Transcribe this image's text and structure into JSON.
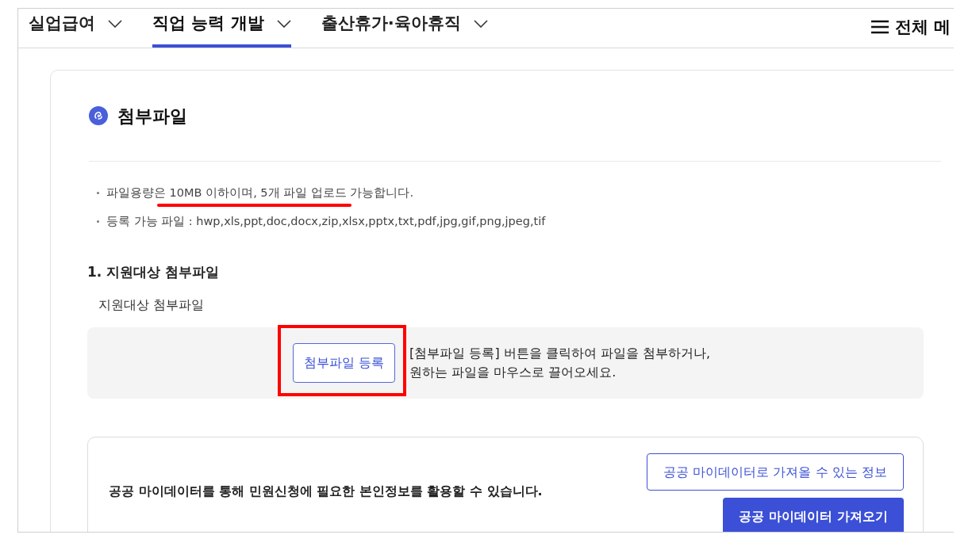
{
  "nav": {
    "tabs": [
      {
        "label": "실업급여",
        "selected": false
      },
      {
        "label": "직업 능력 개발",
        "selected": true
      },
      {
        "label": "출산휴가·육아휴직",
        "selected": false
      }
    ],
    "all_menu": "전체 메"
  },
  "section": {
    "title": "첨부파일",
    "notes": [
      {
        "text": "파일용량은 10MB 이하이며, 5개 파일 업로드 가능합니다.",
        "underlined": true
      },
      {
        "text": "등록 가능 파일 : hwp,xls,ppt,doc,docx,zip,xlsx,pptx,txt,pdf,jpg,gif,png,jpeg,tif",
        "underlined": false
      }
    ],
    "subheading": "1. 지원대상 첨부파일",
    "field_label": "지원대상 첨부파일",
    "upload": {
      "button": "첨부파일 등록",
      "highlighted": true,
      "hint_lines": [
        "[첨부파일 등록] 버튼을 클릭하여 파일을 첨부하거나,",
        "원하는 파일을 마우스로 끌어오세요."
      ]
    }
  },
  "mydata": {
    "text": "공공 마이데이터를 통해 민원신청에 필요한 본인정보를 활용할 수 있습니다.",
    "info_button": "공공 마이데이터로 가져올 수 있는 정보",
    "fetch_button": "공공 마이데이터 가져오기"
  }
}
